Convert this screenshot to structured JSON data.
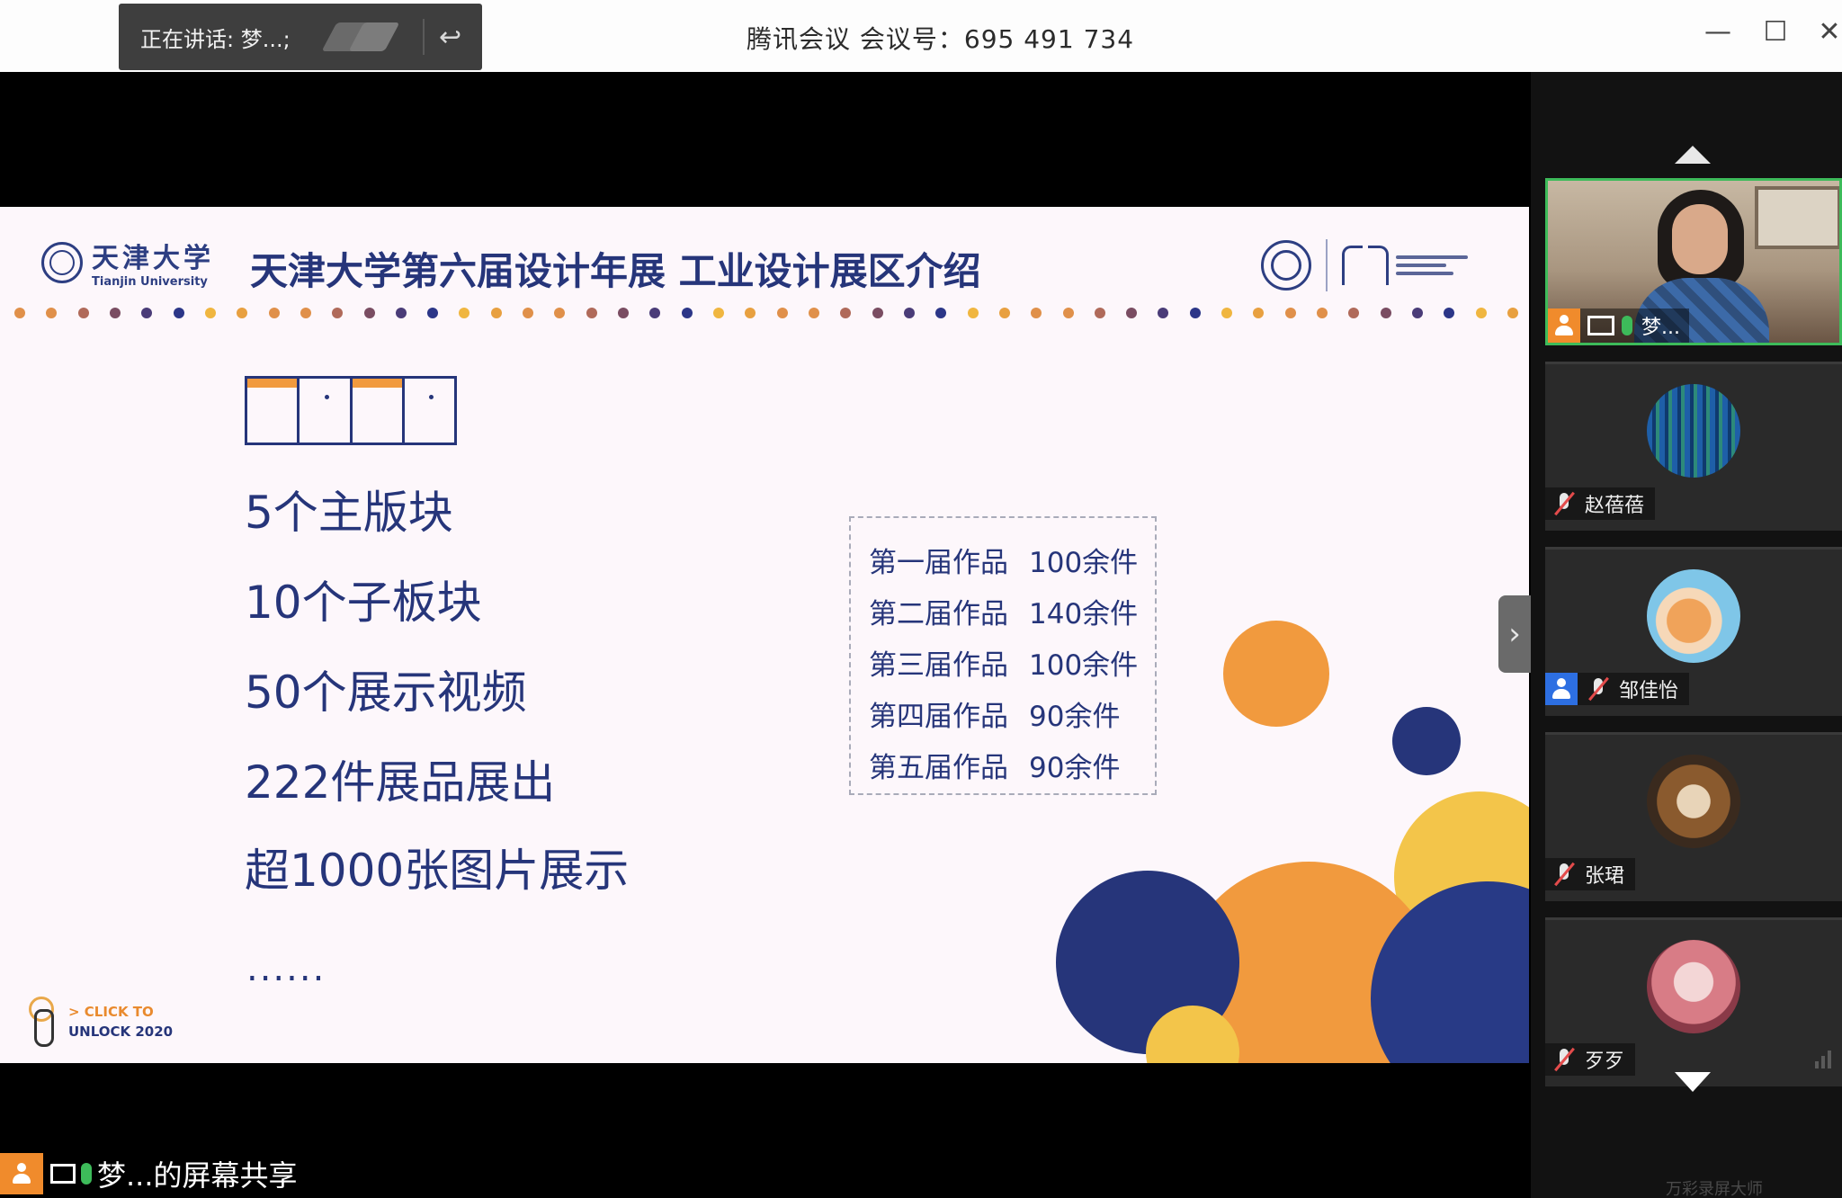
{
  "titlebar": {
    "speaker_label": "正在讲话: 梦...;",
    "meeting_title": "腾讯会议 会议号：695 491 734",
    "minimize": "—",
    "maximize": "☐",
    "close": "✕",
    "back_icon": "↩"
  },
  "slide": {
    "university_cn": "天津大学",
    "university_en": "Tianjin University",
    "title": "天津大学第六届设计年展 工业设计展区介绍",
    "stats": [
      "5个主版块",
      "10个子板块",
      "50个展示视频",
      "222件展品展出",
      "超1000张图片展示"
    ],
    "ellipsis": "......",
    "editions": [
      {
        "name": "第一届作品",
        "count": "100余件"
      },
      {
        "name": "第二届作品",
        "count": "140余件"
      },
      {
        "name": "第三届作品",
        "count": "100余件"
      },
      {
        "name": "第四届作品",
        "count": "90余件"
      },
      {
        "name": "第五届作品",
        "count": "90余件"
      }
    ],
    "unlock_line1": "> CLICK TO",
    "unlock_line2": "UNLOCK 2020",
    "next_arrow": "›",
    "colors": {
      "navy": "#26357a",
      "orange": "#f19a3e",
      "yellow": "#f3c54a"
    }
  },
  "participants": [
    {
      "name": "梦...",
      "video": true,
      "active_speaker": true
    },
    {
      "name": "赵蓓蓓",
      "video": false
    },
    {
      "name": "邹佳怡",
      "video": false,
      "user_badge": true
    },
    {
      "name": "张珺",
      "video": false
    },
    {
      "name": "歹歹",
      "video": false
    }
  ],
  "bottom": {
    "share_label": "梦...的屏幕共享"
  },
  "watermark": "万彩录屏大师"
}
